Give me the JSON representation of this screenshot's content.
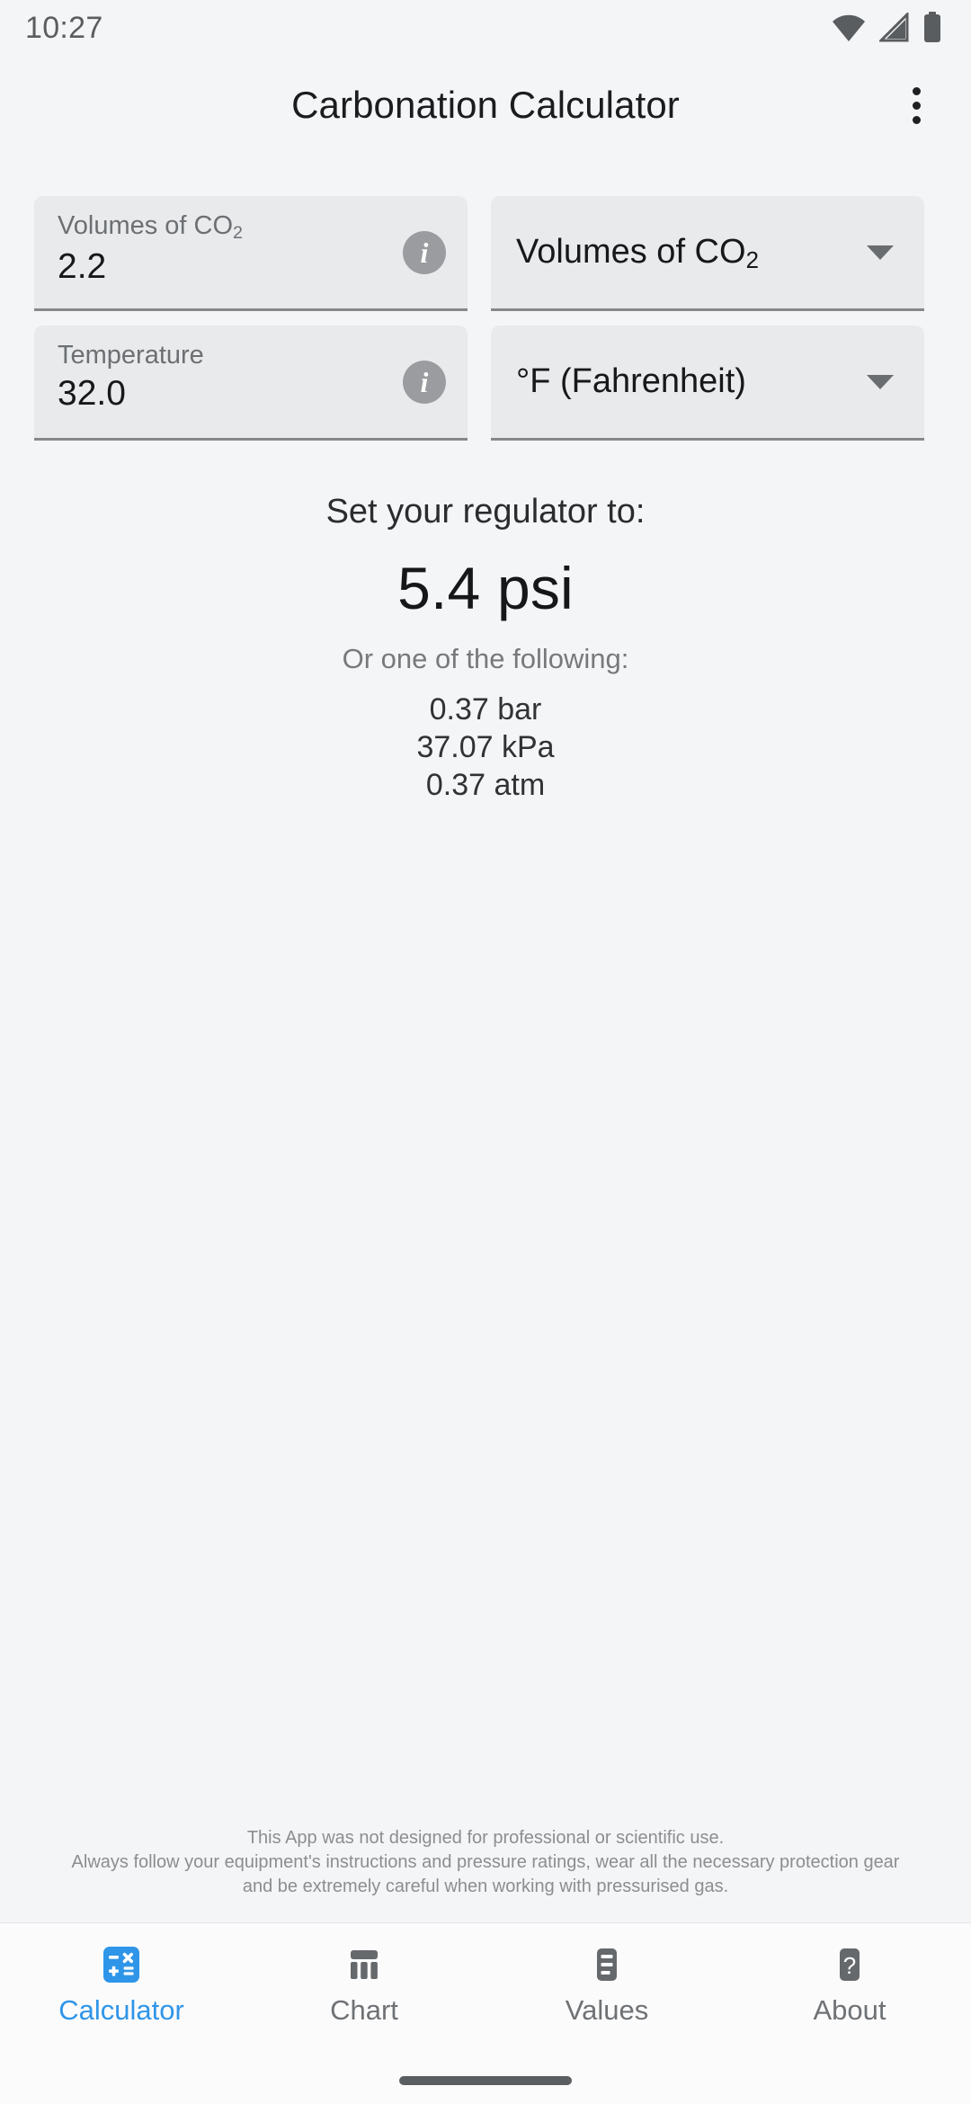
{
  "status_bar": {
    "time": "10:27",
    "icons": [
      "wifi-icon",
      "cellular-signal-icon",
      "battery-icon"
    ]
  },
  "app_bar": {
    "title": "Carbonation Calculator",
    "overflow_menu": "overflow-menu-icon"
  },
  "form": {
    "volumes_field": {
      "label": "Volumes of CO",
      "label_sub": "2",
      "value": "2.2",
      "info_icon": "i"
    },
    "volumes_unit_dropdown": {
      "value": "Volumes of CO",
      "value_sub": "2",
      "icon": "chevron-down-icon"
    },
    "temperature_field": {
      "label": "Temperature",
      "value": "32.0",
      "info_icon": "i"
    },
    "temperature_unit_dropdown": {
      "value": "°F (Fahrenheit)",
      "icon": "chevron-down-icon"
    }
  },
  "results": {
    "caption": "Set your regulator to:",
    "primary": "5.4 psi",
    "sub_caption": "Or one of the following:",
    "alternates": [
      "0.37 bar",
      "37.07 kPa",
      "0.37 atm"
    ]
  },
  "disclaimer": {
    "line1": "This App was not designed for professional or scientific use.",
    "line2": "Always follow your equipment's instructions and pressure ratings, wear all the necessary protection gear",
    "line3": "and be extremely careful when working with pressurised gas."
  },
  "bottom_nav": {
    "active_color": "#2f95e8",
    "inactive_color": "#6f7275",
    "items": [
      {
        "label": "Calculator",
        "icon": "calculator-icon",
        "active": true
      },
      {
        "label": "Chart",
        "icon": "bar-chart-icon",
        "active": false
      },
      {
        "label": "Values",
        "icon": "list-icon",
        "active": false
      },
      {
        "label": "About",
        "icon": "question-mark-icon",
        "active": false
      }
    ]
  },
  "colors": {
    "background": "#f4f5f6",
    "field_fill": "#e8eaec",
    "accent_blue": "#2f95e8",
    "icon_gray": "#6a6d70"
  }
}
